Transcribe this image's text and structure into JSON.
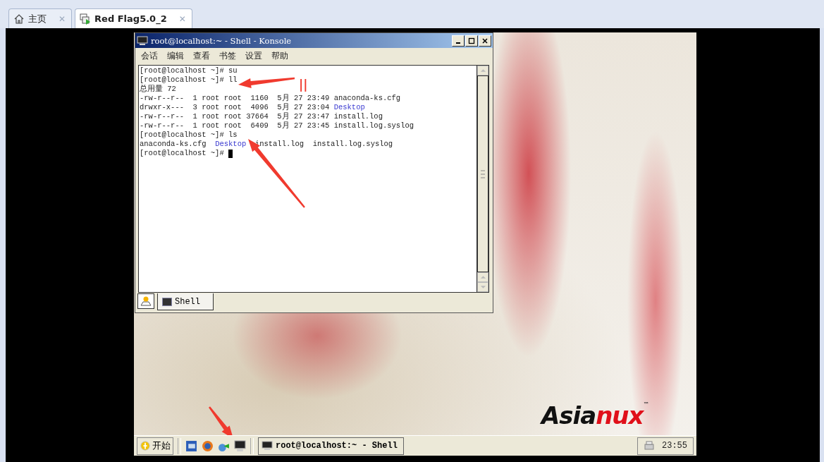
{
  "host_tabs": [
    {
      "label": "主页",
      "kind": "home",
      "selected": false,
      "close": "✕"
    },
    {
      "label": "Red Flag5.0_2",
      "kind": "vm",
      "selected": true,
      "close": "✕"
    }
  ],
  "konsole": {
    "title": "root@localhost:~ - Shell - Konsole",
    "menu": [
      "会话",
      "编辑",
      "查看",
      "书签",
      "设置",
      "帮助"
    ],
    "lines": [
      {
        "segments": [
          {
            "text": "[root@localhost ~]# su",
            "kind": "plain"
          }
        ],
        "cursor": false
      },
      {
        "segments": [
          {
            "text": "[root@localhost ~]# ll",
            "kind": "plain"
          }
        ],
        "cursor": false
      },
      {
        "segments": [
          {
            "text": "总用量 72",
            "kind": "plain"
          }
        ],
        "cursor": false
      },
      {
        "segments": [
          {
            "text": "-rw-r--r--  1 root root  1160  5月 27 23:49 anaconda-ks.cfg",
            "kind": "plain"
          }
        ],
        "cursor": false
      },
      {
        "segments": [
          {
            "text": "drwxr-x---  3 root root  4096  5月 27 23:04 ",
            "kind": "plain"
          },
          {
            "text": "Desktop",
            "kind": "dir"
          }
        ],
        "cursor": false
      },
      {
        "segments": [
          {
            "text": "-rw-r--r--  1 root root 37664  5月 27 23:47 install.log",
            "kind": "plain"
          }
        ],
        "cursor": false
      },
      {
        "segments": [
          {
            "text": "-rw-r--r--  1 root root  6409  5月 27 23:45 install.log.syslog",
            "kind": "plain"
          }
        ],
        "cursor": false
      },
      {
        "segments": [
          {
            "text": "[root@localhost ~]# ls",
            "kind": "plain"
          }
        ],
        "cursor": false
      },
      {
        "segments": [
          {
            "text": "anaconda-ks.cfg  ",
            "kind": "plain"
          },
          {
            "text": "Desktop",
            "kind": "dir"
          },
          {
            "text": "  install.log  install.log.syslog",
            "kind": "plain"
          }
        ],
        "cursor": false
      },
      {
        "segments": [
          {
            "text": "[root@localhost ~]# ",
            "kind": "plain"
          }
        ],
        "cursor": true
      }
    ],
    "session_tab": "Shell"
  },
  "annotation_text": "||",
  "logo": {
    "part_1": "Asia",
    "part_2": "nux",
    "trademark": "™"
  },
  "taskbar": {
    "start": "开始",
    "task": "root@localhost:~ - Shell",
    "clock": "23:55"
  }
}
